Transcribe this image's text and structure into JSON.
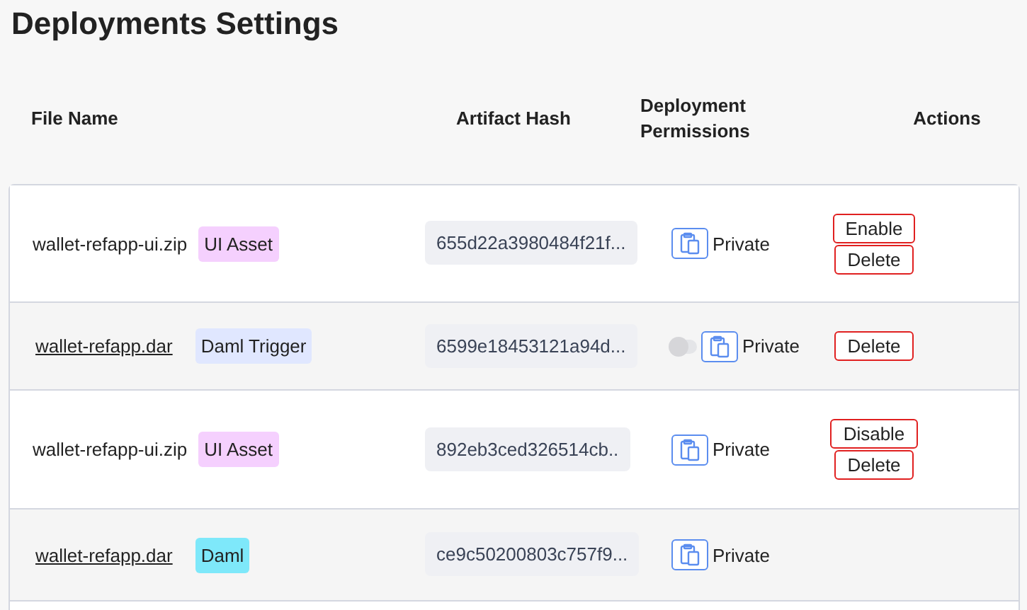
{
  "title": "Deployments Settings",
  "columns": [
    "File Name",
    "Artifact Hash",
    "Deployment Permissions",
    "Actions"
  ],
  "rows": [
    {
      "file": "wallet-refapp-ui.zip",
      "kind": "text",
      "tag": {
        "label": "UI Asset",
        "color": "#f5d0fe"
      },
      "hash": "655d22a3980484f21f...",
      "permission": "Private",
      "actions": [
        "Enable",
        "Delete"
      ]
    },
    {
      "file": "wallet-refapp.dar",
      "kind": "link",
      "tag": {
        "label": "Daml Trigger",
        "color": "#e0e7ff"
      },
      "hash": "6599e18453121a94d...",
      "toggle": {
        "on": false
      },
      "permission": "Private",
      "actions": [
        "Delete"
      ]
    },
    {
      "file": "wallet-refapp-ui.zip",
      "kind": "text",
      "tag": {
        "label": "UI Asset",
        "color": "#f5d0fe"
      },
      "hash": "892eb3ced326514cb..",
      "permission": "Private",
      "actions": [
        "Disable",
        "Delete"
      ]
    },
    {
      "file": "wallet-refapp.dar",
      "kind": "link",
      "tag": {
        "label": "Daml",
        "color": "#7ee8fa"
      },
      "hash": "ce9c50200803c757f9...",
      "permission": "Private",
      "actions": []
    }
  ]
}
